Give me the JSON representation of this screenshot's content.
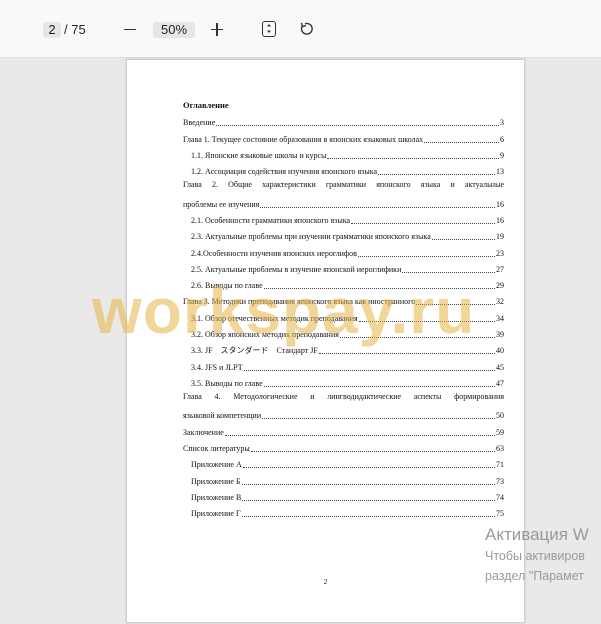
{
  "toolbar": {
    "page_current": "2",
    "page_total": "/ 75",
    "zoom_level": "50%"
  },
  "document": {
    "toc_title": "Оглавление",
    "entries": [
      {
        "text": "Введение",
        "page": "3",
        "indent": false
      },
      {
        "text": "Глава 1. Текущее состояние образования в японских языковых школах",
        "page": "6",
        "indent": false
      },
      {
        "text": "1.1. Японские языковые школы и курсы",
        "page": "9",
        "indent": true
      },
      {
        "text": "1.2. Ассоциация содействия изучения японского языка",
        "page": "13",
        "indent": true
      },
      {
        "text_line1": "Глава 2. Общие характеристики грамматики японского языка и актуальные",
        "text_line2": "проблемы ее изучения",
        "page": "16",
        "indent": false
      },
      {
        "text": "2.1. Особенности грамматики японского языка",
        "page": "16",
        "indent": true
      },
      {
        "text": "2.3. Актуальные проблемы при изучении грамматики японского языка",
        "page": "19",
        "indent": true
      },
      {
        "text": "2.4.Особенности изучения японских иероглифов",
        "page": "23",
        "indent": true
      },
      {
        "text": "2.5. Актуальные проблемы в изучение японской иероглифики",
        "page": "27",
        "indent": true
      },
      {
        "text": "2.6. Выводы по главе",
        "page": "29",
        "indent": true
      },
      {
        "text": "Глава 3. Методики преподавания японского языка как иностранного",
        "page": "32",
        "indent": false
      },
      {
        "text": "3.1. Обзор отечественных методик преподавания",
        "page": "34",
        "indent": true
      },
      {
        "text": "3.2. Обзор японских методик преподавания",
        "page": "39",
        "indent": true
      },
      {
        "text": "3.3. JF　スタンダード　Стандарт JF",
        "page": "40",
        "indent": true
      },
      {
        "text": "3.4. JFS и JLPT",
        "page": "45",
        "indent": true
      },
      {
        "text": "3.5. Выводы по главе",
        "page": "47",
        "indent": true
      },
      {
        "text_line1": "Глава 4. Методологические и лингводидактические аспекты формирования",
        "text_line2": "языковой компетенции",
        "page": "50",
        "indent": false
      },
      {
        "text": "Заключение",
        "page": "59",
        "indent": false
      },
      {
        "text": "Список литературы",
        "page": "63",
        "indent": false
      },
      {
        "text": "Приложение А",
        "page": "71",
        "indent": true
      },
      {
        "text": "Приложение Б",
        "page": "73",
        "indent": true
      },
      {
        "text": "Приложение В",
        "page": "74",
        "indent": true
      },
      {
        "text": "Приложение Г",
        "page": "75",
        "indent": true
      }
    ],
    "footer_page_number": "2"
  },
  "watermark": {
    "text": "workspay.ru"
  },
  "os_overlay": {
    "title": "Активация W",
    "line1": "Чтобы активиров",
    "line2": "раздел \"Парамет"
  },
  "colors": {
    "toolbar_bg": "#f9f9f9",
    "canvas_bg": "#e9e9e9",
    "watermark": "#e8b446",
    "overlay_text": "#9a9a9a"
  },
  "icons": {
    "zoom_out": "minus-icon",
    "zoom_in": "plus-icon",
    "fit": "fit-page-icon",
    "rotate": "rotate-icon"
  }
}
